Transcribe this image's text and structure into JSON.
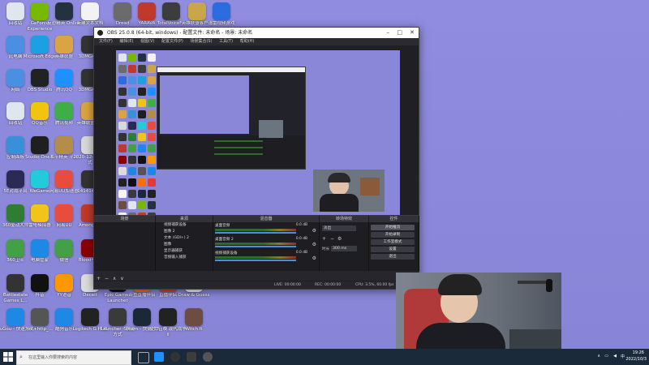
{
  "desktop": {
    "icons": [
      {
        "label": "回收站",
        "color": "#dfe6ee"
      },
      {
        "label": "GeForce Experience",
        "color": "#76b900"
      },
      {
        "label": "反恐精英 Online",
        "color": "#24323f"
      },
      {
        "label": "新建文本文档",
        "color": "#f2f2f2"
      },
      {
        "label": "Dread",
        "color": "#6b6b6b"
      },
      {
        "label": "YARAVA",
        "color": "#c0392b"
      },
      {
        "label": "TotalVoiceFX",
        "color": "#3d3d3d"
      },
      {
        "label": "英雄联盟客户端",
        "color": "#caa64b"
      },
      {
        "label": "迅雷视频游戏",
        "color": "#2d6cdf"
      },
      {
        "label": "此电脑",
        "color": "#4a90e2"
      },
      {
        "label": "Microsoft Edge",
        "color": "#1ba1e2"
      },
      {
        "label": "英雄联盟",
        "color": "#d9a441"
      },
      {
        "label": "3DMGAME",
        "color": "#333333"
      },
      {
        "label": "网络",
        "color": "#4a90e2"
      },
      {
        "label": "OBS Studio",
        "color": "#222222"
      },
      {
        "label": "腾讯QQ",
        "color": "#1e90ff"
      },
      {
        "label": "3DMGAME",
        "color": "#333333"
      },
      {
        "label": "回收站",
        "color": "#dfe6ee"
      },
      {
        "label": "QQ音乐",
        "color": "#f1c40f"
      },
      {
        "label": "腾讯视频",
        "color": "#3fae49"
      },
      {
        "label": "英雄联盟 2.0",
        "color": "#d9a441"
      },
      {
        "label": "控制面板",
        "color": "#3a8fd9"
      },
      {
        "label": "Studio One 5",
        "color": "#1f1f1f"
      },
      {
        "label": "和平精英 平台",
        "color": "#b38e4a"
      },
      {
        "label": "2020-12-快捷方式",
        "color": "#d8d8d8"
      },
      {
        "label": "5E对战平台",
        "color": "#2a2a55"
      },
      {
        "label": "WeGame",
        "color": "#21cbd9"
      },
      {
        "label": "网易UU加速器",
        "color": "#e84c3d"
      },
      {
        "label": "141414141",
        "color": "#333333"
      },
      {
        "label": "360驱动大师",
        "color": "#2e7d32"
      },
      {
        "label": "雷电模拟器",
        "color": "#f0c419"
      },
      {
        "label": "网易UU",
        "color": "#e84c3d"
      },
      {
        "label": "Among Us",
        "color": "#c0392b"
      },
      {
        "label": "360卫士",
        "color": "#43a047"
      },
      {
        "label": "电脑管家",
        "color": "#1e88e5"
      },
      {
        "label": "微信",
        "color": "#43a047"
      },
      {
        "label": "Bloodhunt",
        "color": "#8b0000"
      },
      {
        "label": "Battlestate Games L...",
        "color": "#333333"
      },
      {
        "label": "抖音",
        "color": "#111111"
      },
      {
        "label": "YY语音",
        "color": "#ff9800"
      },
      {
        "label": "Deceit",
        "color": "#dcdcdc"
      },
      {
        "label": "KuGou - 快速方式",
        "color": "#1e88e5"
      },
      {
        "label": "src+http_...",
        "color": "#555555"
      },
      {
        "label": "酷狗音乐",
        "color": "#1e88e5"
      },
      {
        "label": "Logitech G HUB",
        "color": "#222222"
      },
      {
        "label": "Epic Games Launcher",
        "color": "#111111"
      },
      {
        "label": "斗鱼直播伴侣",
        "color": "#ff6f00"
      },
      {
        "label": "直播伴侣",
        "color": "#e53935"
      },
      {
        "label": "Draw & Guess",
        "color": "#f5f5f5"
      },
      {
        "label": "Launcher - 快捷方式",
        "color": "#3a3a3a"
      },
      {
        "label": "Steam - 快捷方式",
        "color": "#1b2838"
      },
      {
        "label": "使命召唤 现代战争II",
        "color": "#222222"
      },
      {
        "label": "Witch It",
        "color": "#6d4c41"
      }
    ]
  },
  "obs": {
    "title": "OBS 25.0.8 (64-bit, windows) - 配置文件: 未命名 - 场景: 未命名",
    "menu": [
      "文件(F)",
      "编辑(E)",
      "视图(V)",
      "配置文件(P)",
      "场景集合(S)",
      "工具(T)",
      "帮助(H)"
    ],
    "panels": {
      "scenes": "场景",
      "sources": "来源",
      "mixer": "混音器",
      "transitions": "转场特效",
      "controls": "控件"
    },
    "sources": [
      "视频捕获设备",
      "图像 2",
      "文本 (GDI+) 2",
      "图像",
      "显示器捕获",
      "音频输入捕获"
    ],
    "mixer": [
      {
        "name": "桌面音频",
        "db": "0.0 dB"
      },
      {
        "name": "桌面音频 2",
        "db": "0.0 dB"
      },
      {
        "name": "视频捕获设备",
        "db": "0.0 dB"
      }
    ],
    "transition": {
      "type": "淡出",
      "duration_label": "时长",
      "duration_value": "300 ms"
    },
    "controls": [
      "开始推流",
      "开始录制",
      "工作室模式",
      "设置",
      "退出"
    ],
    "status": {
      "live": "LIVE: 00:00:00",
      "rec": "REC: 00:00:00",
      "cpu": "CPU: 3.5%, 60.00 fps"
    }
  },
  "taskbar": {
    "search_placeholder": "在这里输入你要搜索的内容",
    "time": "19:26",
    "date": "2022/10/3",
    "ime": "中"
  }
}
